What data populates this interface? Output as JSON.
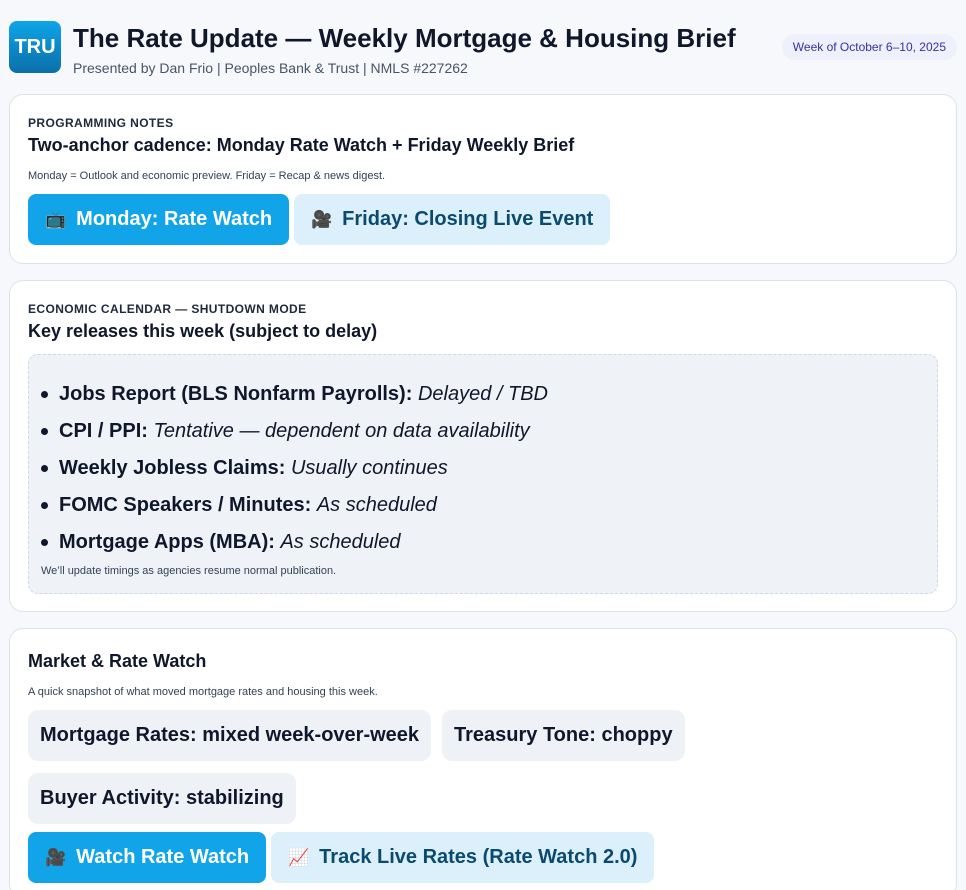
{
  "header": {
    "logo_text": "TRU",
    "title": "The Rate Update — Weekly Mortgage & Housing Brief",
    "subtitle": "Presented by Dan Frio | Peoples Bank & Trust | NMLS #227262",
    "week_badge": "Week of October 6–10, 2025"
  },
  "programming": {
    "kicker": "PROGRAMMING NOTES",
    "title": "Two-anchor cadence: Monday Rate Watch + Friday Weekly Brief",
    "note": "Monday = Outlook and economic preview. Friday = Recap & news digest.",
    "buttons": [
      {
        "icon": "📺",
        "icon_name": "tv-icon",
        "label": "Monday: Rate Watch"
      },
      {
        "icon": "🎥",
        "icon_name": "video-camera-icon",
        "label": "Friday: Closing Live Event"
      }
    ]
  },
  "calendar": {
    "kicker": "ECONOMIC CALENDAR — SHUTDOWN MODE",
    "title": "Key releases this week (subject to delay)",
    "items": [
      {
        "label": "Jobs Report (BLS Nonfarm Payrolls):",
        "status": "Delayed / TBD"
      },
      {
        "label": "CPI / PPI:",
        "status": "Tentative — dependent on data availability"
      },
      {
        "label": "Weekly Jobless Claims:",
        "status": "Usually continues"
      },
      {
        "label": "FOMC Speakers / Minutes:",
        "status": "As scheduled"
      },
      {
        "label": "Mortgage Apps (MBA):",
        "status": "As scheduled"
      }
    ],
    "note": "We’ll update timings as agencies resume normal publication."
  },
  "market": {
    "title": "Market & Rate Watch",
    "note": "A quick snapshot of what moved mortgage rates and housing this week.",
    "chips": [
      "Mortgage Rates: mixed week-over-week",
      "Treasury Tone: choppy",
      "Buyer Activity: stabilizing"
    ],
    "buttons": [
      {
        "icon": "🎥",
        "icon_name": "video-camera-icon",
        "label": "Watch Rate Watch"
      },
      {
        "icon": "📈",
        "icon_name": "chart-increasing-icon",
        "label": "Track Live Rates (Rate Watch 2.0)"
      }
    ]
  },
  "colors": {
    "primary": "#12a4e8",
    "secondary_bg": "#dcf0fb",
    "badge_bg": "#eef0fc",
    "badge_text": "#3730a3"
  }
}
